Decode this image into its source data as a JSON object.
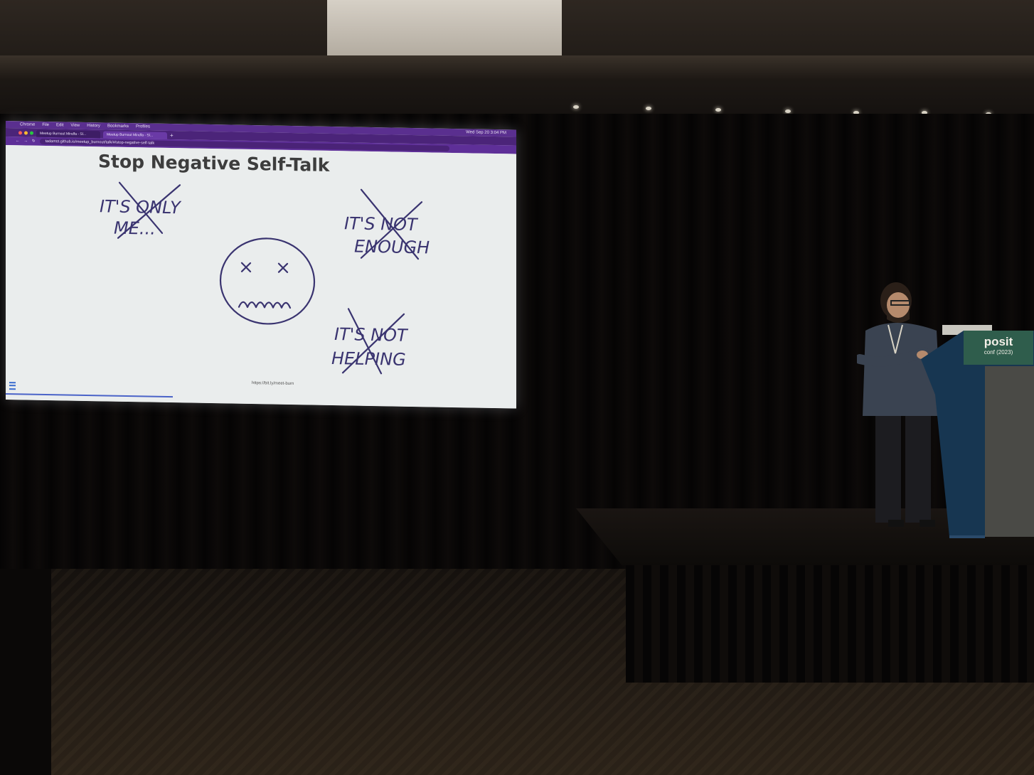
{
  "browser": {
    "menu": [
      "Chrome",
      "File",
      "Edit",
      "View",
      "History",
      "Bookmarks",
      "Profiles"
    ],
    "tabs": [
      "Meetup Burnout Mindfa - Sl...",
      "Meetup Burnout Mindfa - Sl..."
    ],
    "url": "tadamst.github.io/meetup_burnout/talk/#/stop-negative-self-talk",
    "clock": "Wed Sep 20 3:04 PM"
  },
  "slide": {
    "title": "Stop Negative Self-Talk",
    "doodles": {
      "phrase1_line1": "IT'S ONLY",
      "phrase1_line2": "ME...",
      "phrase2_line1": "IT'S NOT",
      "phrase2_line2": "ENOUGH",
      "phrase3_line1": "IT'S NOT",
      "phrase3_line2": "HELPING"
    },
    "footer_url": "https://bit.ly/meet-burn"
  },
  "podium": {
    "brand": "posit",
    "event": "conf (2023)"
  },
  "colors": {
    "browser_purple": "#5a2f8f",
    "slide_bg": "#eaeded",
    "ink": "#3a3470",
    "posit_green": "#2f5d4c"
  }
}
